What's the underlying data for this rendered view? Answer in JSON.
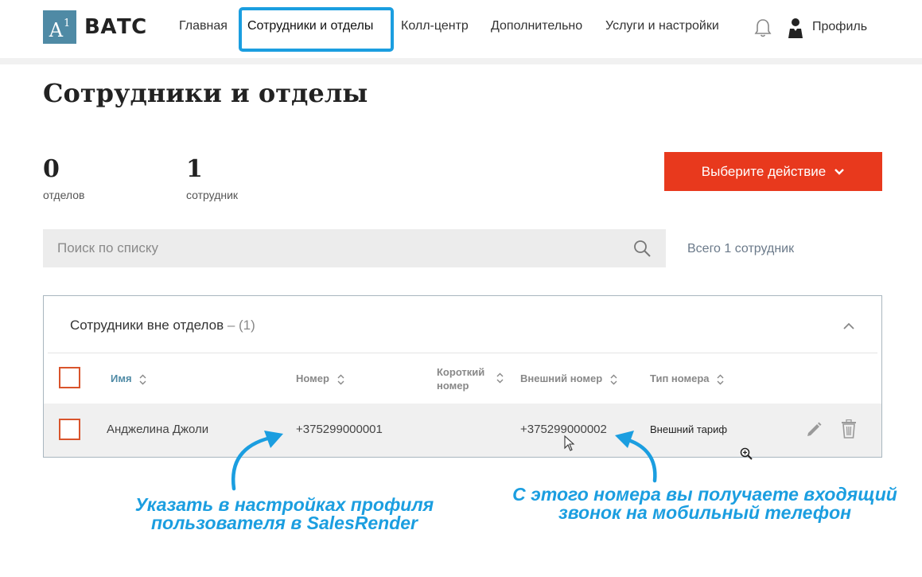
{
  "header": {
    "logo_mark": "A",
    "logo_sup": "1",
    "logo_text": "ВАТС",
    "nav": [
      "Главная",
      "Сотрудники и отделы",
      "Колл-центр",
      "Дополнительно",
      "Услуги и настройки"
    ],
    "profile_label": "Профиль",
    "icons": [
      "bell-icon",
      "user-icon"
    ]
  },
  "page": {
    "title": "Сотрудники и отделы"
  },
  "stats": [
    {
      "value": "0",
      "label": "отделов"
    },
    {
      "value": "1",
      "label": "сотрудник"
    }
  ],
  "action_button": {
    "label": "Выберите действие",
    "color": "#e8391d"
  },
  "search": {
    "placeholder": "Поиск по списку",
    "total": "Всего 1 сотрудник"
  },
  "group": {
    "title": "Сотрудники вне отделов",
    "count": "– (1)"
  },
  "table": {
    "columns": [
      "Имя",
      "Номер",
      "Короткий номер",
      "Внешний номер",
      "Тип номера"
    ],
    "short_col_lines": [
      "Короткий",
      "номер"
    ],
    "rows": [
      {
        "name": "Анджелина Джоли",
        "number": "+375299000001",
        "short": "",
        "external": "+375299000002",
        "type": "Внешний тариф"
      }
    ]
  },
  "annotations": {
    "left": [
      "Указать в настройках профиля",
      "пользователя в SalesRender"
    ],
    "right": [
      "С этого номера вы получаете входящий",
      "звонок на мобильный телефон"
    ],
    "color": "#1b9ee0"
  }
}
